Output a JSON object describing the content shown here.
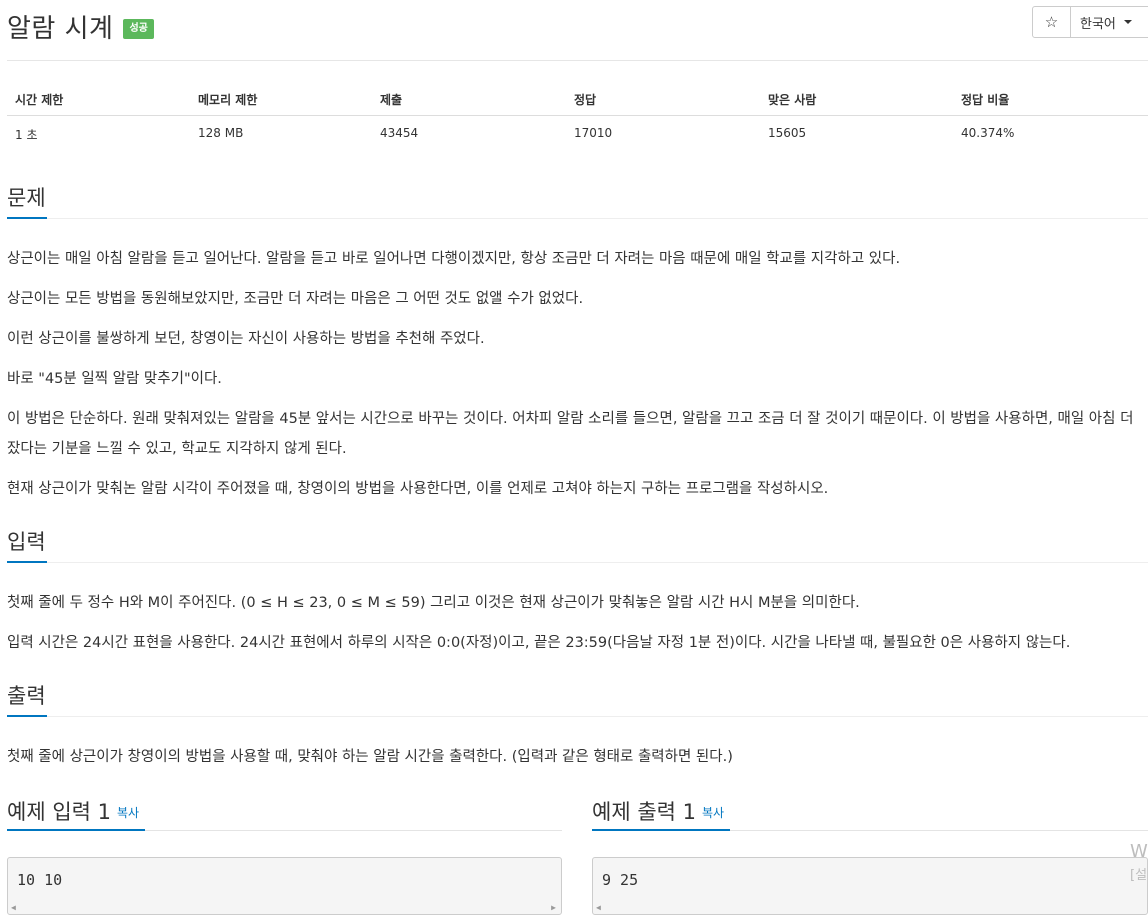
{
  "problem": {
    "title": "알람 시계",
    "status_badge": "성공"
  },
  "toolbar": {
    "star_icon": "☆",
    "language": "한국어"
  },
  "info_table": {
    "headers": [
      "시간 제한",
      "메모리 제한",
      "제출",
      "정답",
      "맞은 사람",
      "정답 비율"
    ],
    "values": [
      "1 초",
      "128 MB",
      "43454",
      "17010",
      "15605",
      "40.374%"
    ]
  },
  "sections": {
    "problem": {
      "title": "문제",
      "paragraphs": [
        "상근이는 매일 아침 알람을 듣고 일어난다. 알람을 듣고 바로 일어나면 다행이겠지만, 항상 조금만 더 자려는 마음 때문에 매일 학교를 지각하고 있다.",
        "상근이는 모든 방법을 동원해보았지만, 조금만 더 자려는 마음은 그 어떤 것도 없앨 수가 없었다.",
        "이런 상근이를 불쌍하게 보던, 창영이는 자신이 사용하는 방법을 추천해 주었다.",
        "바로 \"45분 일찍 알람 맞추기\"이다.",
        "이 방법은 단순하다. 원래 맞춰져있는 알람을 45분 앞서는 시간으로 바꾸는 것이다. 어차피 알람 소리를 들으면, 알람을 끄고 조금 더 잘 것이기 때문이다. 이 방법을 사용하면, 매일 아침 더 잤다는 기분을 느낄 수 있고, 학교도 지각하지 않게 된다.",
        "현재 상근이가 맞춰논 알람 시각이 주어졌을 때, 창영이의 방법을 사용한다면, 이를 언제로 고쳐야 하는지 구하는 프로그램을 작성하시오."
      ]
    },
    "input": {
      "title": "입력",
      "paragraphs": [
        "첫째 줄에 두 정수 H와 M이 주어진다. (0 ≤ H ≤ 23, 0 ≤ M ≤ 59) 그리고 이것은 현재 상근이가 맞춰놓은 알람 시간 H시 M분을 의미한다.",
        "입력 시간은 24시간 표현을 사용한다. 24시간 표현에서 하루의 시작은 0:0(자정)이고, 끝은 23:59(다음날 자정 1분 전)이다. 시간을 나타낼 때, 불필요한 0은 사용하지 않는다."
      ]
    },
    "output": {
      "title": "출력",
      "paragraphs": [
        "첫째 줄에 상근이가 창영이의 방법을 사용할 때, 맞춰야 하는 알람 시간을 출력한다. (입력과 같은 형태로 출력하면 된다.)"
      ]
    }
  },
  "samples": {
    "input": {
      "title": "예제 입력 1",
      "copy_label": "복사",
      "value": "10 10"
    },
    "output": {
      "title": "예제 출력 1",
      "copy_label": "복사",
      "value": "9 25"
    }
  },
  "watermark": {
    "line1": "W",
    "line2": "[설"
  }
}
